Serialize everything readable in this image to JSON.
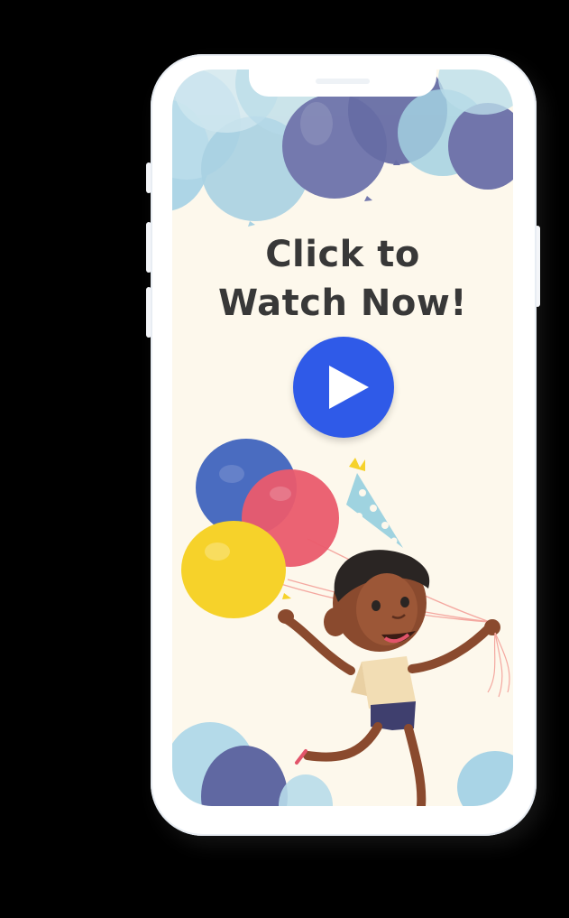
{
  "screen": {
    "headline_line1": "Click to",
    "headline_line2": "Watch Now!"
  },
  "icons": {
    "play": "play-icon"
  },
  "colors": {
    "background": "#fdf8ec",
    "play_button": "#2f5ae8",
    "headline_text": "#383838",
    "balloon_blue": "#4a6cc0",
    "balloon_red": "#ea5b6d",
    "balloon_yellow": "#f6d22a",
    "balloon_light_blue": "#a8d3e4",
    "balloon_navy": "#6a6fa8"
  }
}
